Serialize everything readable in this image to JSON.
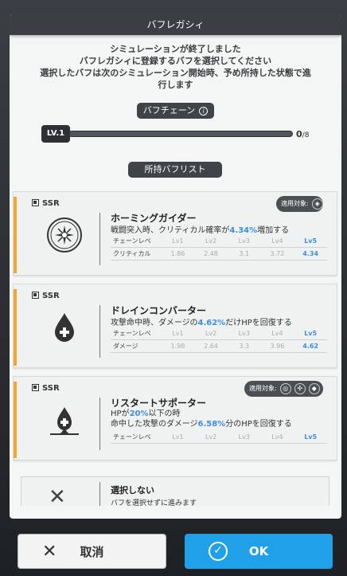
{
  "modal": {
    "title": "バフレガシィ",
    "intro_lines": [
      "シミュレーションが終了しました",
      "バフレガシィに登録するバフを選択してください",
      "選択したバフは次のシミュレーション開始時、予め所持した状態で進",
      "行します"
    ],
    "chain_label": "バフチェーン",
    "info_icon": "info-icon",
    "level_badge": "LV.1",
    "progress_fraction": 0,
    "count_value": "0",
    "count_max": "/8",
    "owned_label": "所持バフリスト"
  },
  "buffs": [
    {
      "rarity": "SSR",
      "name": "ホーミングガイダー",
      "desc_pre": "戦闘突入時、クリティカル確率が",
      "desc_hl": "4.34%",
      "desc_post": "増加する",
      "icon": "crosshair-burst-icon",
      "apply_label": "適用対象:",
      "apply_icons": [
        "diamond-target-icon"
      ],
      "table_header": [
        "チェーンレベ",
        "Lv1",
        "Lv2",
        "Lv3",
        "Lv4",
        "Lv5"
      ],
      "table_row": [
        "クリティカル",
        "1.86",
        "2.48",
        "3.1",
        "3.72",
        "4.34"
      ]
    },
    {
      "rarity": "SSR",
      "name": "ドレインコンバーター",
      "desc_pre": "攻撃命中時、ダメージの",
      "desc_hl": "4.62%",
      "desc_post": "だけHPを回復する",
      "icon": "blood-drop-plus-icon",
      "table_header": [
        "チェーンレベ",
        "Lv1",
        "Lv2",
        "Lv3",
        "Lv4",
        "Lv5"
      ],
      "table_row": [
        "ダメージ",
        "1.98",
        "2.64",
        "3.3",
        "3.96",
        "4.62"
      ]
    },
    {
      "rarity": "SSR",
      "name": "リスタートサポーター",
      "desc1_pre": "HPが",
      "desc1_hl": "20%",
      "desc1_post": "以下の時",
      "desc2_pre": "命中した攻撃のダメージ",
      "desc2_hl": "6.58%",
      "desc2_post": "分のHPを回復する",
      "icon": "drop-plus-base-icon",
      "apply_label": "適用対象:",
      "apply_icons": [
        "target-icon",
        "scatter-icon",
        "shield-icon"
      ],
      "table_header": [
        "チェーンレベ",
        "Lv1",
        "Lv2",
        "Lv3",
        "Lv4",
        "Lv5"
      ]
    }
  ],
  "skip": {
    "title": "選択しない",
    "subtitle": "バフを選択せずに進みます",
    "icon": "close-icon"
  },
  "buttons": {
    "cancel_label": "取消",
    "ok_label": "OK"
  },
  "colors": {
    "accent_blue": "#3a8ee6",
    "ok_button": "#1fa0e8",
    "rarity_stripe": "#f2a531",
    "dark_pill": "#3f4448"
  }
}
